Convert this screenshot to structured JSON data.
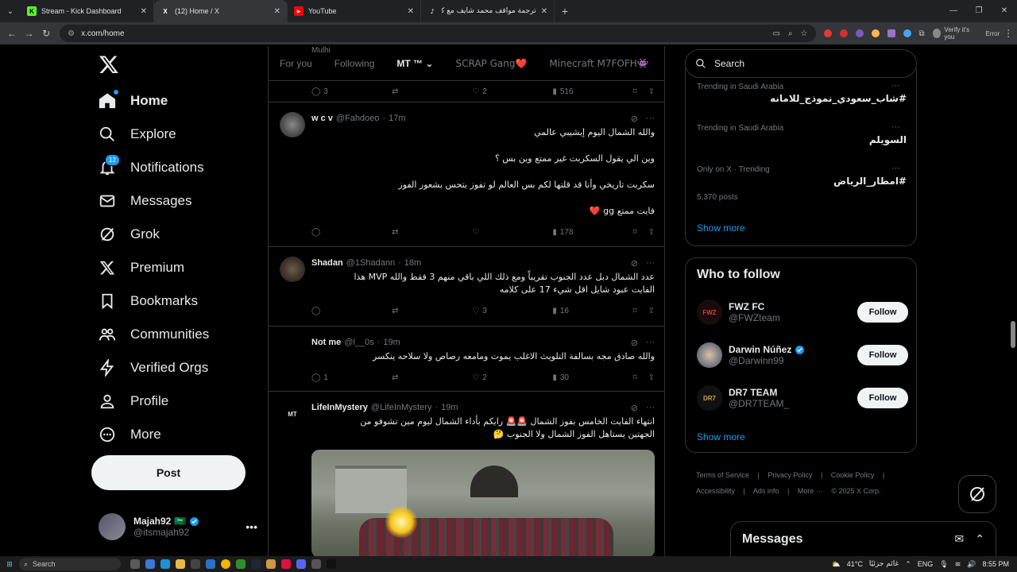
{
  "browser": {
    "tabs": [
      {
        "title": "Stream - Kick Dashboard",
        "favicon": "K",
        "color": "#53fc18"
      },
      {
        "title": "(12) Home / X",
        "favicon": "X",
        "color": "#ffffff"
      },
      {
        "title": "YouTube",
        "favicon": "▶",
        "color": "#ff0000"
      },
      {
        "title": "ترجمة مواقف محمد شايف مع كـ",
        "favicon": "♪",
        "color": "#ffffff"
      }
    ],
    "url": "x.com/home",
    "profile_label": "Verify it's you",
    "error_label": "Error"
  },
  "nav": {
    "items": [
      {
        "label": "Home",
        "icon": "home-icon"
      },
      {
        "label": "Explore",
        "icon": "search-icon"
      },
      {
        "label": "Notifications",
        "icon": "bell-icon",
        "badge": "12"
      },
      {
        "label": "Messages",
        "icon": "mail-icon"
      },
      {
        "label": "Grok",
        "icon": "grok-icon"
      },
      {
        "label": "Premium",
        "icon": "x-icon"
      },
      {
        "label": "Bookmarks",
        "icon": "bookmark-icon"
      },
      {
        "label": "Communities",
        "icon": "people-icon"
      },
      {
        "label": "Verified Orgs",
        "icon": "lightning-icon"
      },
      {
        "label": "Profile",
        "icon": "person-icon"
      },
      {
        "label": "More",
        "icon": "more-circle-icon"
      }
    ],
    "post_label": "Post",
    "account": {
      "display_name": "Majah92",
      "flag": "🇸🇦",
      "handle": "@itsmajah92"
    }
  },
  "feed": {
    "tabs": [
      "For you",
      "Following",
      "MT ™",
      "SCRAP Gang❤️",
      "Minecraft M7FOFH👾"
    ],
    "ghost_name": "Mulhi",
    "top_stats": {
      "replies": "3",
      "likes": "2",
      "views": "516"
    },
    "tweets": [
      {
        "name": "w c v",
        "handle": "@Fahdoeo",
        "time": "17m",
        "lines": [
          "والله الشمال اليوم إيشيبي عالمي",
          "وين الي يقول السكربت غير ممتع وين بس ؟",
          "سكربت تاريخي وأنا قد قلتها لكم بس العالم لو تفوز بتحس بشعور الفوز",
          "فايت ممتع gg ❤️"
        ],
        "replies": "",
        "likes": "",
        "views": "178"
      },
      {
        "name": "Shadan",
        "handle": "@1Shadann",
        "time": "18m",
        "lines": [
          "عدد الشمال دبل عدد الجنوب تقريباً ومع ذلك اللي باقي منهم 3 فقط والله MVP هذا",
          "الفايت عبود شايل اقل شيء 17 على كلامه"
        ],
        "replies": "",
        "likes": "3",
        "views": "16"
      },
      {
        "name": "Not me",
        "handle": "@l__0s",
        "time": "19m",
        "lines": [
          "والله صادق مجه بسالفة التلويث الاغلب يموت ومامعه رصاص ولا سلاحه ينكسر"
        ],
        "replies": "1",
        "likes": "2",
        "views": "30"
      },
      {
        "name": "LifeInMystery",
        "handle": "@LifeInMystery",
        "time": "19m",
        "lines": [
          "انتهاء الفايت الخامس بفوز الشمال 🚨🚨 رايكم بأداء الشمال ليوم مين تشوفو من",
          "الجهتين يستاهل الفوز الشمال ولا الجنوب 🤔"
        ],
        "avatar_text": "MT"
      }
    ]
  },
  "right": {
    "search_placeholder": "Search",
    "trends": [
      {
        "context": "Trending in Saudi Arabia",
        "title": "#شاب_سعودي_نموذج_للامانه"
      },
      {
        "context": "Trending in Saudi Arabia",
        "title": "السويلم"
      },
      {
        "context": "Only on X · Trending",
        "title": "#امطار_الرياض",
        "count": "5,370 posts"
      }
    ],
    "show_more": "Show more",
    "who_to_follow": {
      "title": "Who to follow",
      "accounts": [
        {
          "name": "FWZ FC",
          "handle": "@FWZteam",
          "avatar_text": "FWZ",
          "verified": false
        },
        {
          "name": "Darwin Núñez",
          "handle": "@Darwinn99",
          "avatar_text": "",
          "verified": true
        },
        {
          "name": "DR7 TEAM",
          "handle": "@DR7TEAM_",
          "avatar_text": "DR7",
          "verified": false
        }
      ],
      "follow_label": "Follow",
      "show_more": "Show more"
    },
    "footer": [
      "Terms of Service",
      "|",
      "Privacy Policy",
      "|",
      "Cookie Policy",
      "|",
      "Accessibility",
      "|",
      "Ads info",
      "|",
      "More ···",
      "© 2025 X Corp."
    ],
    "messages_title": "Messages"
  },
  "taskbar": {
    "search": "Search",
    "weather": "41°C",
    "weather_text": "غائم جزئيًا",
    "lang": "ENG",
    "time": "8:55 PM"
  },
  "colors": {
    "accent": "#1d9bf0",
    "border": "#2f3336",
    "muted": "#71767b"
  }
}
